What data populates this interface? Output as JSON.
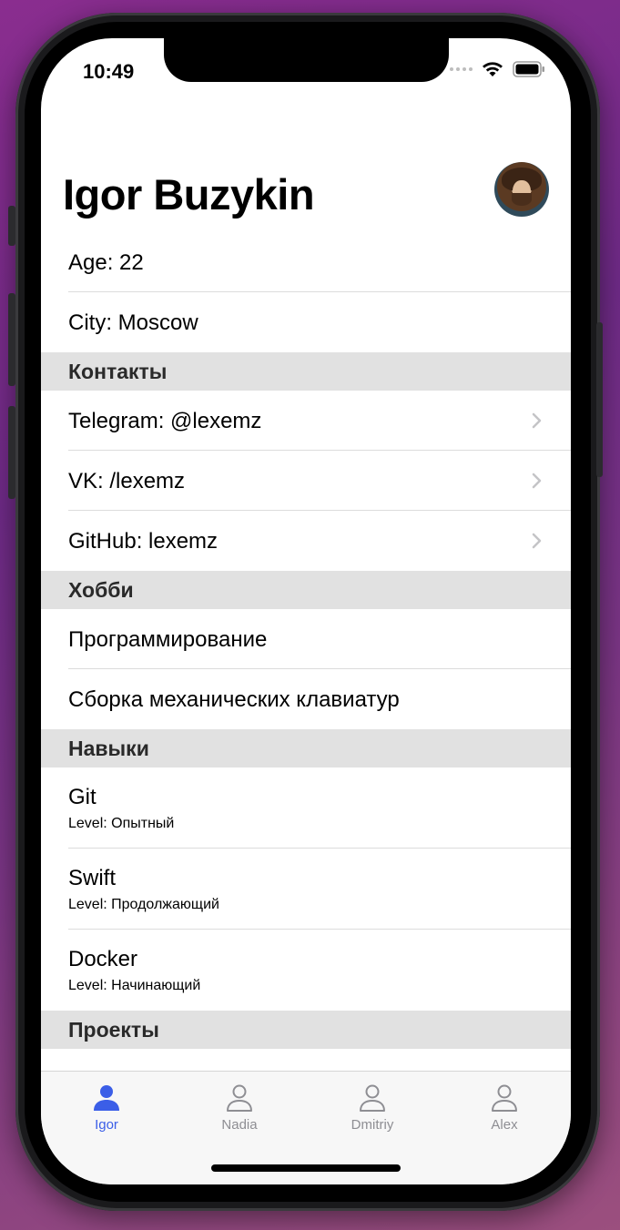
{
  "status_bar": {
    "time": "10:49"
  },
  "header": {
    "title": "Igor Buzykin",
    "avatar_icon": "avatar-photo"
  },
  "info": [
    {
      "label": "Age: 22"
    },
    {
      "label": "City: Moscow"
    }
  ],
  "contacts": {
    "title": "Контакты",
    "items": [
      {
        "label": "Telegram: @lexemz"
      },
      {
        "label": "VK: /lexemz"
      },
      {
        "label": "GitHub: lexemz"
      }
    ]
  },
  "hobbies": {
    "title": "Хобби",
    "items": [
      {
        "label": "Программирование"
      },
      {
        "label": "Сборка механических клавиатур"
      }
    ]
  },
  "skills": {
    "title": "Навыки",
    "items": [
      {
        "name": "Git",
        "level": "Level: Опытный"
      },
      {
        "name": "Swift",
        "level": "Level: Продолжающий"
      },
      {
        "name": "Docker",
        "level": "Level: Начинающий"
      }
    ]
  },
  "projects": {
    "title": "Проекты"
  },
  "tabbar": {
    "accent_color": "#3b5ee7",
    "inactive_color": "#8e8e93",
    "tabs": [
      {
        "label": "Igor",
        "icon": "person-fill-icon",
        "active": true
      },
      {
        "label": "Nadia",
        "icon": "person-icon",
        "active": false
      },
      {
        "label": "Dmitriy",
        "icon": "person-icon",
        "active": false
      },
      {
        "label": "Alex",
        "icon": "person-icon",
        "active": false
      }
    ]
  }
}
